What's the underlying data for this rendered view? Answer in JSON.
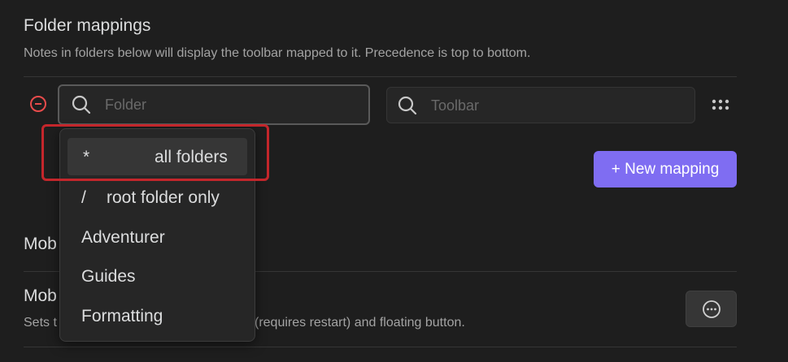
{
  "section": {
    "title": "Folder mappings",
    "description": "Notes in folders below will display the toolbar mapped to it. Precedence is top to bottom."
  },
  "mapping_row": {
    "folder_placeholder": "Folder",
    "toolbar_placeholder": "Toolbar"
  },
  "new_mapping_label": "+ New mapping",
  "folder_options": [
    {
      "symbol": "*",
      "label": "all folders",
      "selected": true
    },
    {
      "symbol": "/",
      "label": "root folder only",
      "selected": false
    },
    {
      "symbol": "",
      "label": "Adventurer",
      "selected": false
    },
    {
      "symbol": "",
      "label": "Guides",
      "selected": false
    },
    {
      "symbol": "",
      "label": "Formatting",
      "selected": false
    }
  ],
  "mobile_section": {
    "heading_visible": "Mob",
    "item_title_visible": "Mob",
    "item_desc_start": "Sets t",
    "item_desc_end": "(requires restart) and floating button."
  },
  "colors": {
    "accent": "#7f6df2",
    "danger": "#e84b4b",
    "highlight": "#c4262b",
    "background": "#1e1e1e"
  },
  "icons": {
    "remove": "minus-circle-icon",
    "search": "search-icon",
    "drag": "dots-grid-icon",
    "more": "more-horizontal-icon"
  }
}
